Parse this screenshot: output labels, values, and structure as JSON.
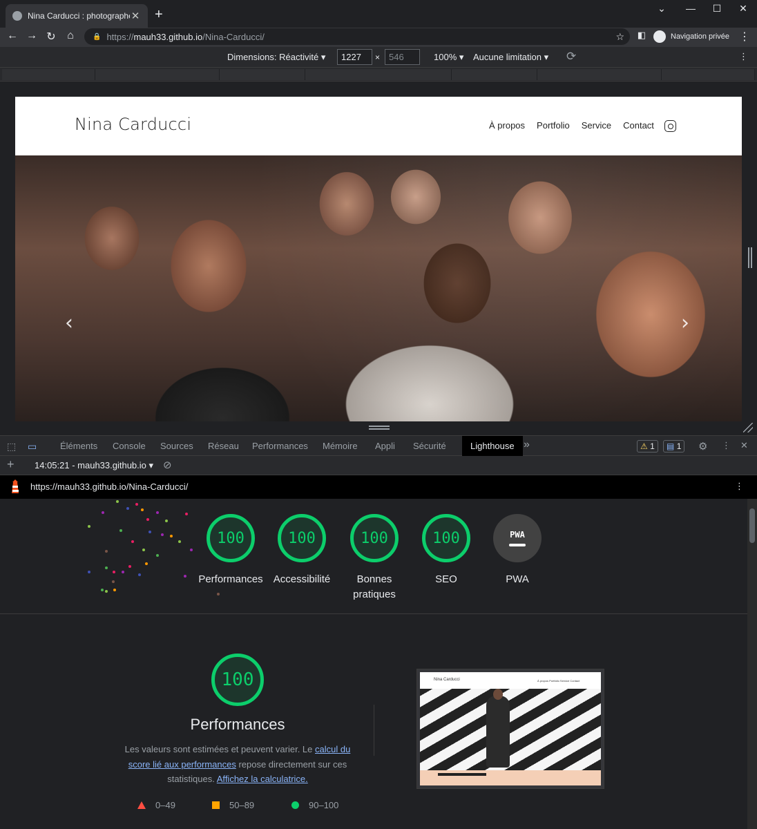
{
  "browser": {
    "tab_title": "Nina Carducci : photographe pas",
    "url_scheme": "https://",
    "url_host": "mauh33.github.io",
    "url_path": "/Nina-Carducci/",
    "profile_label": "Navigation privée"
  },
  "device_toolbar": {
    "dimensions_label": "Dimensions: Réactivité",
    "width": "1227",
    "height": "546",
    "times": "×",
    "zoom": "100%",
    "throttle": "Aucune limitation"
  },
  "site": {
    "title": "Nina Carducci",
    "nav": [
      "À propos",
      "Portfolio",
      "Service",
      "Contact"
    ]
  },
  "devtools": {
    "tabs": [
      "Éléments",
      "Console",
      "Sources",
      "Réseau",
      "Performances",
      "Mémoire",
      "Appli",
      "Sécurité"
    ],
    "active_tab": "Lighthouse",
    "more": "»",
    "warnings": "1",
    "messages": "1"
  },
  "lighthouse": {
    "report_time": "14:05:21 - mauh33.github.io",
    "report_url": "https://mauh33.github.io/Nina-Carducci/",
    "gauges": [
      {
        "score": "100",
        "label": "Performances"
      },
      {
        "score": "100",
        "label": "Accessibilité"
      },
      {
        "score": "100",
        "label": "Bonnes pratiques"
      },
      {
        "score": "100",
        "label": "SEO"
      }
    ],
    "pwa": {
      "badge": "PWA",
      "label": "PWA"
    },
    "perf_score": "100",
    "perf_title": "Performances",
    "desc_1": "Les valeurs sont estimées et peuvent varier. Le ",
    "desc_link_1": "calcul du score lié aux performances",
    "desc_2": " repose directement sur ces statistiques. ",
    "desc_link_2": "Affichez la calculatrice.",
    "legend": {
      "fail": "0–49",
      "average": "50–89",
      "pass": "90–100"
    },
    "thumb_title": "Nina Carducci",
    "thumb_nav": "À propos  Portfolio  Service  Contact",
    "colors": {
      "pass": "#0cce6b",
      "average": "#ffa400",
      "fail": "#ff4e42"
    }
  }
}
